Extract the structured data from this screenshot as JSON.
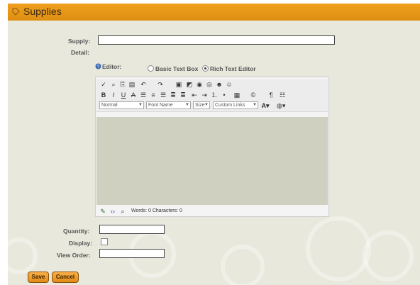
{
  "header": {
    "title": "Supplies"
  },
  "form": {
    "supply_label": "Supply:",
    "detail_label": "Detail:",
    "editor_label": "Editor:",
    "editor_options": [
      "Basic Text Box",
      "Rich Text Editor"
    ],
    "editor_selected": "Rich Text Editor",
    "quantity_label": "Quantity:",
    "display_label": "Display:",
    "view_order_label": "View Order:",
    "supply_value": "",
    "quantity_value": "",
    "view_order_value": "",
    "display_checked": false
  },
  "editor": {
    "toolbar_row2": [
      "B",
      "I",
      "U",
      "A"
    ],
    "format_select": "Normal",
    "font_select": "Font Name",
    "size_select": "Size",
    "links_select": "Custom Links",
    "status": "Words: 0 Characters: 0"
  },
  "buttons": {
    "save": "Save",
    "cancel": "Cancel"
  },
  "colors": {
    "header": "#e8961a",
    "background": "#e8e8dc",
    "editor_area": "#cfd0c0"
  }
}
